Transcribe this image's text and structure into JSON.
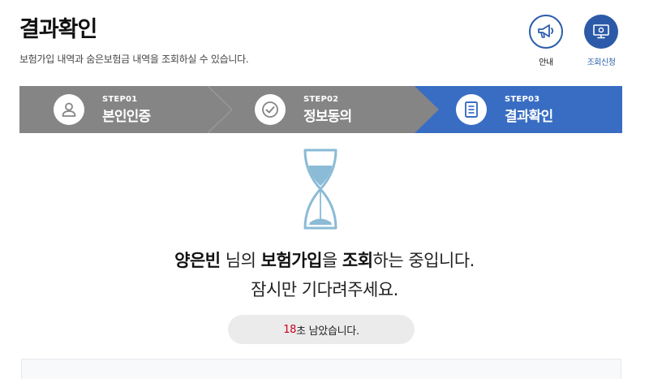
{
  "header": {
    "title": "결과확인",
    "description": "보험가입 내역과 숨은보험금 내역을 조회하실 수 있습니다."
  },
  "top_buttons": {
    "guide": {
      "label": "안내",
      "icon": "megaphone-icon"
    },
    "inquiry": {
      "label": "조회신청",
      "icon": "monitor-icon"
    }
  },
  "steps": [
    {
      "num": "STEP01",
      "name": "본인인증",
      "icon": "person-icon",
      "active": false
    },
    {
      "num": "STEP02",
      "name": "정보동의",
      "icon": "check-circle-icon",
      "active": false
    },
    {
      "num": "STEP03",
      "name": "결과확인",
      "icon": "document-icon",
      "active": true
    }
  ],
  "message": {
    "name": "양은빈",
    "honorific": " 님의 ",
    "insurance": "보험가입",
    "particle": "을 ",
    "inquiry": "조회",
    "suffix": "하는 중입니다.",
    "line2": "잠시만 기다려주세요."
  },
  "timer": {
    "seconds": "18",
    "suffix": "초 남았습니다."
  },
  "colors": {
    "primary": "#386dc3",
    "step_inactive": "#858585",
    "timer_seconds": "#c8001e"
  }
}
